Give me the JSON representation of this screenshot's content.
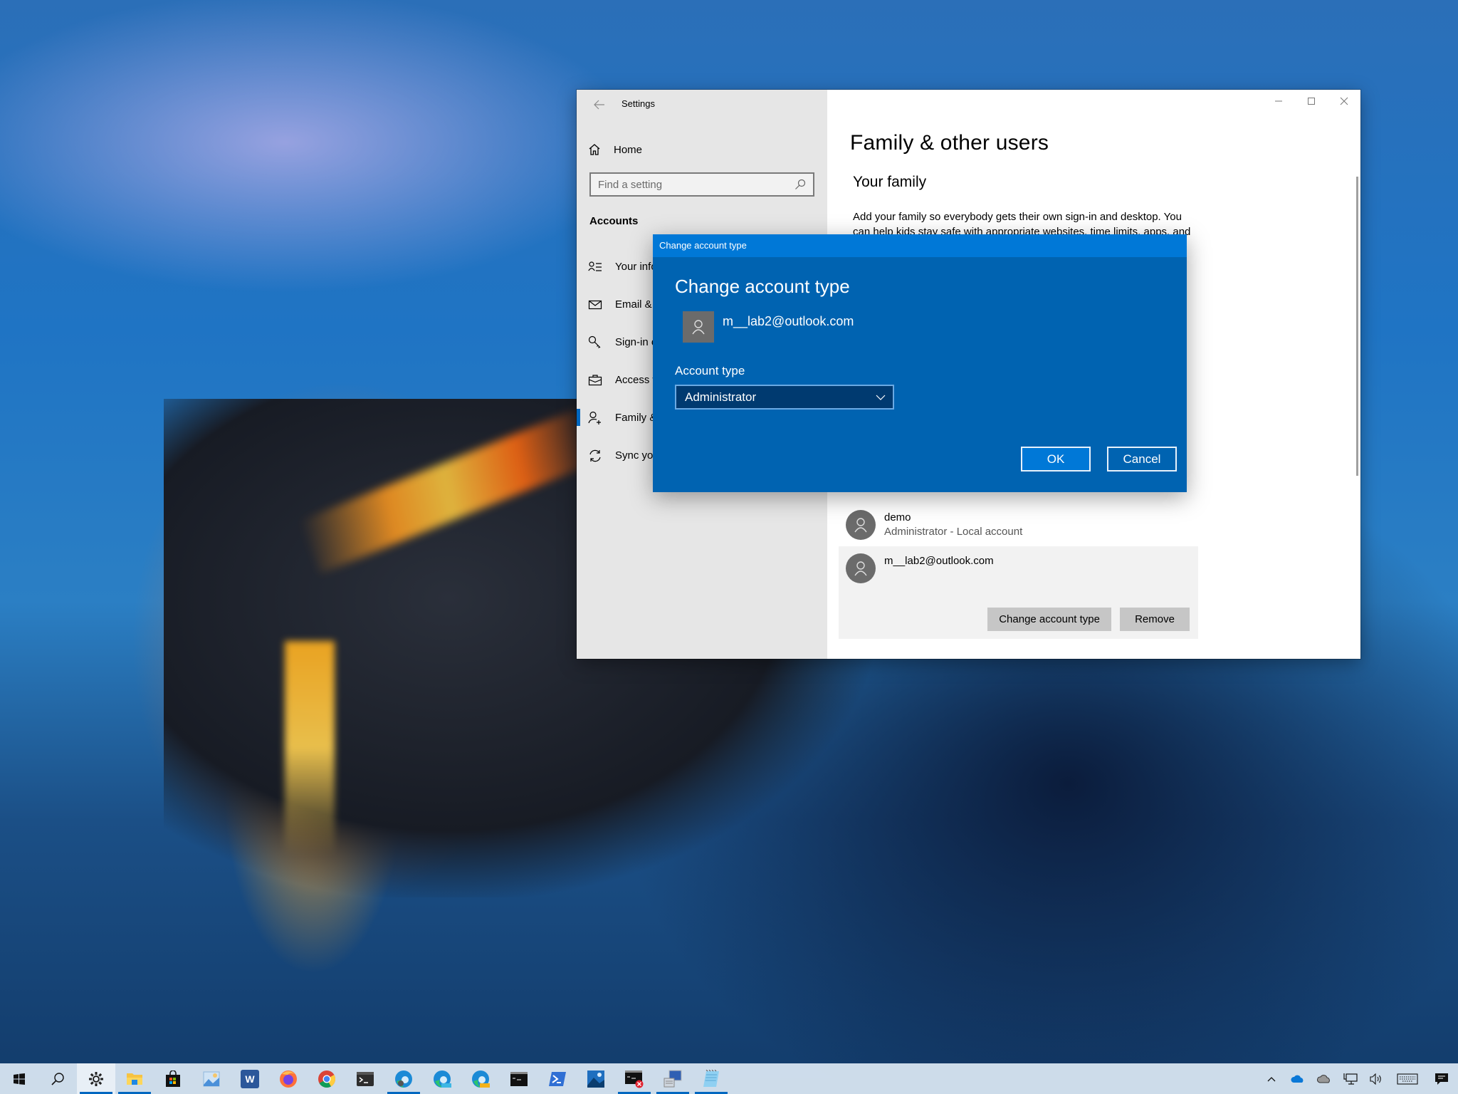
{
  "settings_window": {
    "title": "Settings",
    "sidebar": {
      "home_label": "Home",
      "search_placeholder": "Find a setting",
      "section_label": "Accounts",
      "items": [
        {
          "label": "Your info",
          "icon": "person-list-icon"
        },
        {
          "label": "Email & accounts",
          "icon": "mail-icon"
        },
        {
          "label": "Sign-in options",
          "icon": "key-icon"
        },
        {
          "label": "Access work or school",
          "icon": "briefcase-icon"
        },
        {
          "label": "Family & other users",
          "icon": "person-add-icon",
          "active": true
        },
        {
          "label": "Sync your settings",
          "icon": "sync-icon"
        }
      ]
    },
    "content": {
      "page_title": "Family & other users",
      "section_title": "Your family",
      "description": "Add your family so everybody gets their own sign-in and desktop. You can help kids stay safe with appropriate websites, time limits, apps, and",
      "users": [
        {
          "name": "demo",
          "subtitle": "Administrator - Local account"
        },
        {
          "name": "m__lab2@outlook.com",
          "subtitle": ""
        }
      ],
      "change_account_type_label": "Change account type",
      "remove_label": "Remove"
    }
  },
  "dialog": {
    "titlebar": "Change account type",
    "heading": "Change account type",
    "email": "m__lab2@outlook.com",
    "account_type_label": "Account type",
    "account_type_value": "Administrator",
    "ok_label": "OK",
    "cancel_label": "Cancel",
    "colors": {
      "background": "#0063b1",
      "titlebar": "#0078d7",
      "select": "#003a70"
    }
  },
  "taskbar": {
    "items": [
      {
        "name": "start-button",
        "icon": "windows-logo-icon"
      },
      {
        "name": "search-button",
        "icon": "search-icon"
      },
      {
        "name": "settings-app",
        "icon": "gear-icon",
        "active": true,
        "running": true
      },
      {
        "name": "file-explorer",
        "icon": "folder-icon",
        "running": true
      },
      {
        "name": "microsoft-store",
        "icon": "store-bag-icon"
      },
      {
        "name": "photos-editor",
        "icon": "image-edit-icon"
      },
      {
        "name": "word",
        "icon": "word-icon",
        "glyph": "W"
      },
      {
        "name": "firefox",
        "icon": "firefox-icon"
      },
      {
        "name": "chrome",
        "icon": "chrome-icon"
      },
      {
        "name": "terminal",
        "icon": "terminal-icon"
      },
      {
        "name": "edge-dev",
        "icon": "edge-icon",
        "running": true
      },
      {
        "name": "edge-beta",
        "icon": "edge-beta-icon",
        "badge": "BETA"
      },
      {
        "name": "edge-canary",
        "icon": "edge-canary-icon",
        "badge": "CAN"
      },
      {
        "name": "command-prompt",
        "icon": "cmd-icon"
      },
      {
        "name": "powershell",
        "icon": "powershell-icon"
      },
      {
        "name": "photos",
        "icon": "photos-icon"
      },
      {
        "name": "cmd-admin-error",
        "icon": "cmd-error-icon",
        "running": true
      },
      {
        "name": "network-manager",
        "icon": "computer-network-icon",
        "running": true
      },
      {
        "name": "notepad",
        "icon": "notepad-icon",
        "running": true
      }
    ],
    "tray": [
      {
        "name": "show-hidden-icons",
        "icon": "chevron-up-icon"
      },
      {
        "name": "onedrive",
        "icon": "cloud-blue-icon"
      },
      {
        "name": "onedrive-personal",
        "icon": "cloud-gray-icon"
      },
      {
        "name": "network",
        "icon": "network-icon"
      },
      {
        "name": "volume",
        "icon": "speaker-icon"
      },
      {
        "name": "touch-keyboard",
        "icon": "keyboard-icon"
      },
      {
        "name": "action-center",
        "icon": "notification-icon"
      }
    ]
  }
}
